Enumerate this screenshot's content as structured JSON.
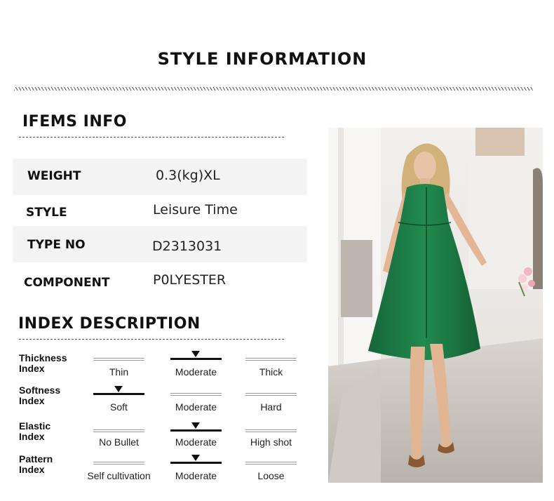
{
  "header": {
    "title": "STYLE INFORMATION"
  },
  "items_info": {
    "title": "IFEMS INFO",
    "rows": [
      {
        "label": "WEIGHT",
        "value": "0.3(kg)XL"
      },
      {
        "label": "STYLE",
        "value": "Leisure Time"
      },
      {
        "label": "TYPE NO",
        "value": "D2313031"
      },
      {
        "label": "COMPONENT",
        "value": "P0LYESTER"
      }
    ]
  },
  "index_description": {
    "title": "INDEX DESCRIPTION",
    "indices": [
      {
        "label": "Thickness Index",
        "options": [
          "Thin",
          "Moderate",
          "Thick"
        ],
        "selected": 1
      },
      {
        "label": "Softness Index",
        "options": [
          "Soft",
          "Moderate",
          "Hard"
        ],
        "selected": 0
      },
      {
        "label": "Elastic Index",
        "options": [
          "No Bullet",
          "Moderate",
          "High shot"
        ],
        "selected": 1
      },
      {
        "label": "Pattern Index",
        "options": [
          "Self cultivation",
          "Moderate",
          "Loose"
        ],
        "selected": 1
      }
    ]
  },
  "photo": {
    "subject": "model-in-green-sleeveless-shirt-dress",
    "dress_color": "#1f7a45"
  }
}
